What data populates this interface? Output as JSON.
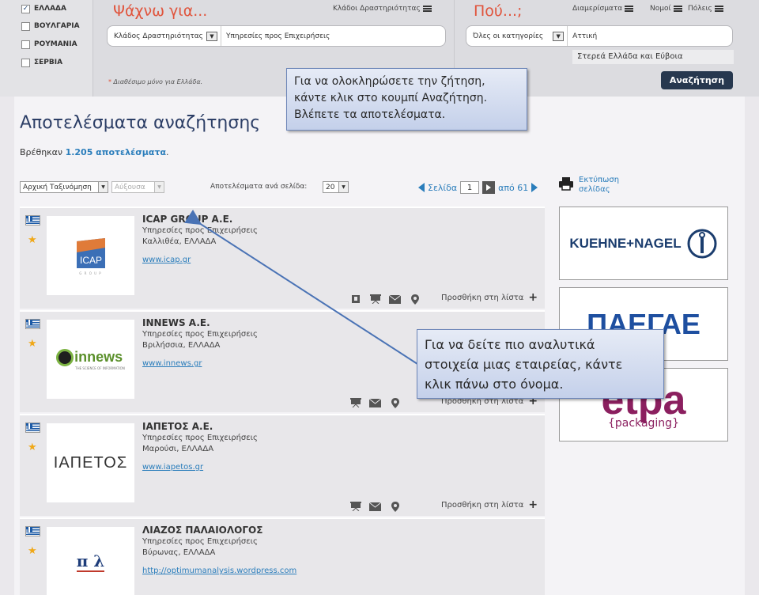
{
  "countries": [
    "ΕΛΛΑΔΑ",
    "ΒΟΥΛΓΑΡΙΑ",
    "ΡΟΥΜΑΝΙΑ",
    "ΣΕΡΒΙΑ"
  ],
  "search": {
    "title_what": "Ψάχνω για...",
    "title_where": "Πού...;",
    "nav_sectors": "Κλάδοι Δραστηριότητας",
    "nav_depts": "Διαμερίσματα",
    "nav_prefectures": "Νομοί",
    "nav_cities": "Πόλεις",
    "field_label": "Κλάδος Δραστηριότητας",
    "field_value": "Υπηρεσίες προς Επιχειρήσεις",
    "category_label": "Όλες οι κατηγορίες",
    "location_value": "Αττική",
    "suggestion": "Στερεά Ελλάδα και Εύβοια",
    "note": "Διαθέσιμο μόνο για Ελλάδα.",
    "button": "Αναζήτηση"
  },
  "results_page": {
    "title": "Αποτελέσματα αναζήτησης",
    "found_prefix": "Βρέθηκαν",
    "found_count": "1.205 αποτελέσματα",
    "found_suffix": ".",
    "sort_value": "Αρχική Ταξινόμηση",
    "order_value": "Αύξουσα",
    "per_page_label": "Αποτελέσματα ανά σελίδα:",
    "per_page_value": "20",
    "page_label": "Σελίδα",
    "page_value": "1",
    "page_of": "από 61",
    "print_label_1": "Εκτύπωση",
    "print_label_2": "σελίδας",
    "add_to_list": "Προσθήκη στη λίστα"
  },
  "results": [
    {
      "name": "ICAP GROUP A.E.",
      "category": "Υπηρεσίες προς Επιχειρήσεις",
      "location": "Καλλιθέα, ΕΛΛΑΔΑ",
      "url": "www.icap.gr",
      "logo_text": "ICAP",
      "logo_sub": "G R O U P"
    },
    {
      "name": "INNEWS A.E.",
      "category": "Υπηρεσίες προς Επιχειρήσεις",
      "location": "Βριλήσσια, ΕΛΛΑΔΑ",
      "url": "www.innews.gr",
      "logo_text": "innews",
      "logo_sub": "THE SCIENCE OF INFORMATION"
    },
    {
      "name": "ΙΑΠΕΤΟΣ Α.Ε.",
      "category": "Υπηρεσίες προς Επιχειρήσεις",
      "location": "Μαρούσι, ΕΛΛΑΔΑ",
      "url": "www.iapetos.gr",
      "logo_text": "ΙΑΠΕΤΟΣ"
    },
    {
      "name": "ΛΙΑΖΟΣ ΠΑΛΑΙΟΛΟΓΟΣ",
      "category": "Υπηρεσίες προς Επιχειρήσεις",
      "location": "Βύρωνας, ΕΛΛΑΔΑ",
      "url": "http://optimumanalysis.wordpress.com",
      "logo_text": "π λ"
    }
  ],
  "ads": [
    {
      "text": "KUEHNE+NAGEL"
    },
    {
      "text": "ΠΑΕΓΑΕ"
    },
    {
      "text": "etpa",
      "sub": "{packaging}"
    }
  ],
  "callouts": {
    "top": [
      "Για να ολοκληρώσετε την ζήτηση,",
      "κάντε κλικ στο κουμπί Αναζήτηση.",
      "Βλέπετε τα αποτελέσματα."
    ],
    "bottom": [
      "Για να δείτε πιο αναλυτικά",
      "στοιχεία μιας εταιρείας, κάντε",
      "κλικ πάνω στο όνομα."
    ]
  },
  "colors": {
    "accent": "#e0543c",
    "link": "#2a7dbb",
    "button": "#27384f",
    "heading": "#2c3e66"
  }
}
